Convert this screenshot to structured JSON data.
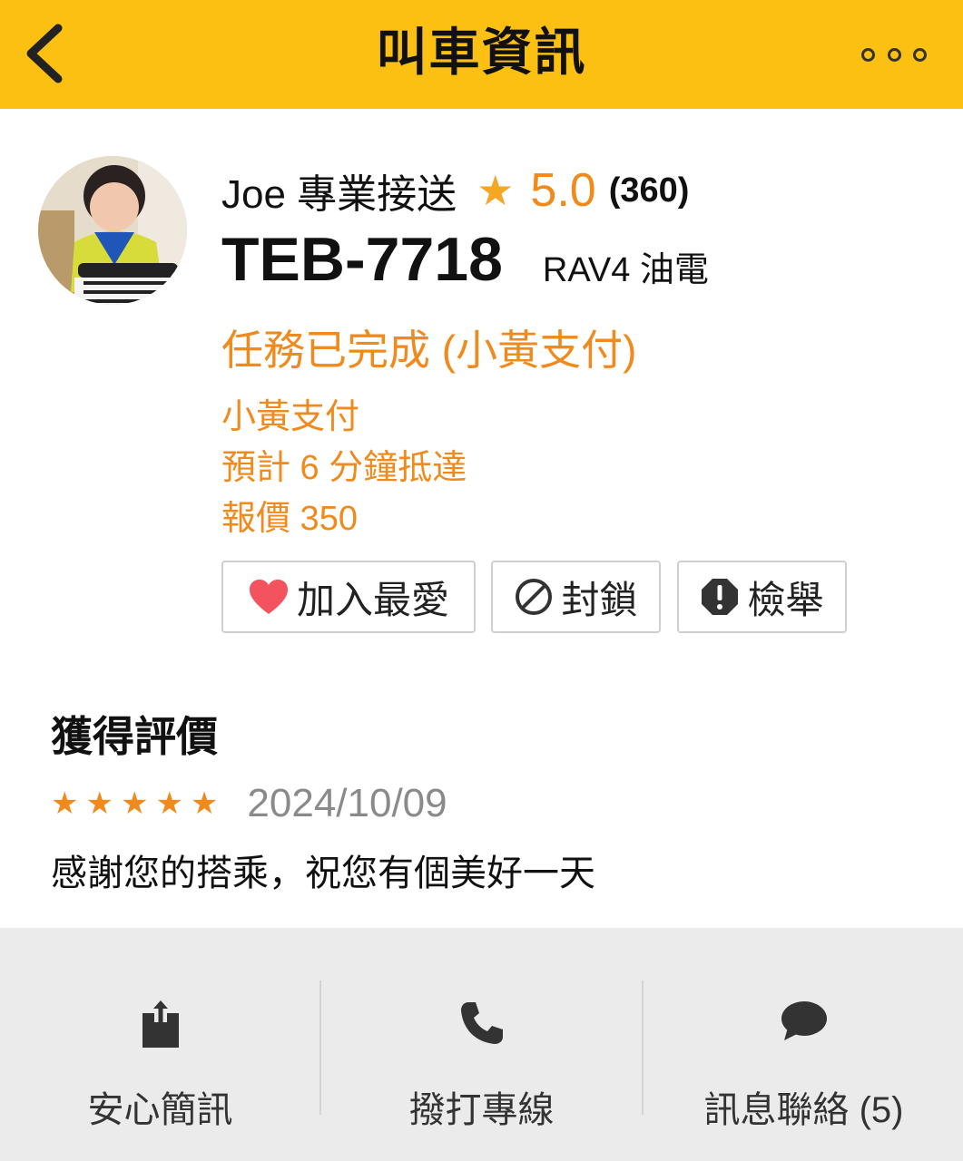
{
  "header": {
    "title": "叫車資訊"
  },
  "driver": {
    "name": "Joe 專業接送",
    "rating_star": "★",
    "rating": "5.0",
    "rating_count": "(360)",
    "plate": "TEB-7718",
    "car_model": "RAV4 油電"
  },
  "trip": {
    "status": "任務已完成 (小黃支付)",
    "payment": "小黃支付",
    "eta": "預計 6 分鐘抵達",
    "quote": "報價 350"
  },
  "actions": {
    "favorite": "加入最愛",
    "block": "封鎖",
    "report": "檢舉"
  },
  "reviews": {
    "title": "獲得評價",
    "items": [
      {
        "stars": "★★★★★",
        "date": "2024/10/09",
        "text": "感謝您的搭乘，祝您有個美好一天"
      }
    ]
  },
  "bottom_bar": {
    "items": [
      {
        "label": "安心簡訊",
        "icon": "share-icon"
      },
      {
        "label": "撥打專線",
        "icon": "phone-icon"
      },
      {
        "label": "訊息聯絡 (5)",
        "icon": "chat-bubble-icon"
      }
    ]
  },
  "colors": {
    "header_bg": "#FBC012",
    "accent_orange": "#F08A1C",
    "star_yellow": "#F5A623",
    "heart_red": "#F2535E",
    "bottom_bar_bg": "#EBEBEB"
  }
}
